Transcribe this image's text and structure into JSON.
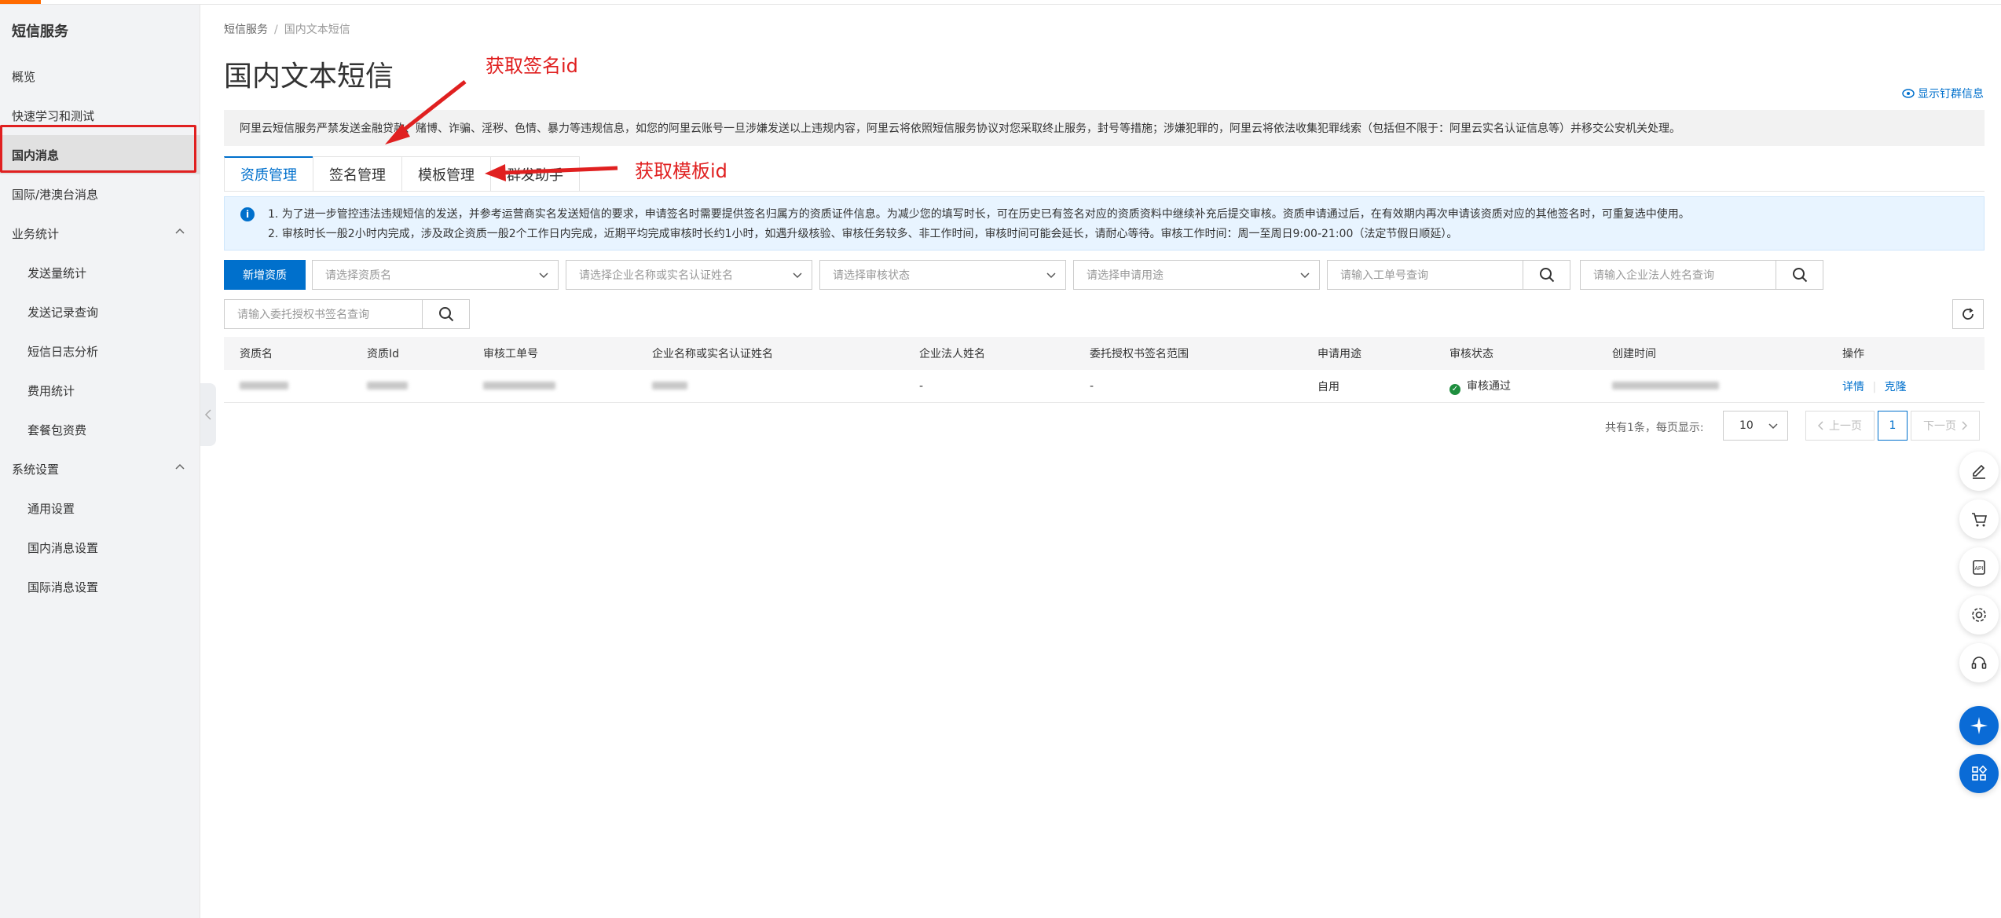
{
  "sidebar": {
    "title": "短信服务",
    "items": [
      {
        "label": "概览"
      },
      {
        "label": "快速学习和测试"
      },
      {
        "label": "国内消息"
      },
      {
        "label": "国际/港澳台消息"
      },
      {
        "label": "业务统计"
      },
      {
        "label": "发送量统计"
      },
      {
        "label": "发送记录查询"
      },
      {
        "label": "短信日志分析"
      },
      {
        "label": "费用统计"
      },
      {
        "label": "套餐包资费"
      },
      {
        "label": "系统设置"
      },
      {
        "label": "通用设置"
      },
      {
        "label": "国内消息设置"
      },
      {
        "label": "国际消息设置"
      }
    ]
  },
  "breadcrumb": {
    "root": "短信服务",
    "sep": "/",
    "current": "国内文本短信"
  },
  "page_title": "国内文本短信",
  "subscribe_link": "显示钉群信息",
  "warning_text": "阿里云短信服务严禁发送金融贷款、赌博、诈骗、淫秽、色情、暴力等违规信息，如您的阿里云账号一旦涉嫌发送以上违规内容，阿里云将依照短信服务协议对您采取终止服务，封号等措施；涉嫌犯罪的，阿里云将依法收集犯罪线索（包括但不限于：阿里云实名认证信息等）并移交公安机关处理。",
  "tabs": [
    {
      "label": "资质管理"
    },
    {
      "label": "签名管理"
    },
    {
      "label": "模板管理"
    },
    {
      "label": "群发助手"
    }
  ],
  "info": {
    "line1": "1. 为了进一步管控违法违规短信的发送，并参考运营商实名发送短信的要求，申请签名时需要提供签名归属方的资质证件信息。为减少您的填写时长，可在历史已有签名对应的资质资料中继续补充后提交审核。资质申请通过后，在有效期内再次申请该资质对应的其他签名时，可重复选中使用。",
    "line2": "2. 审核时长一般2小时内完成，涉及政企资质一般2个工作日内完成，近期平均完成审核时长约1小时，如遇升级核验、审核任务较多、非工作时间，审核时间可能会延长，请耐心等待。审核工作时间：周一至周日9:00-21:00（法定节假日顺延）。"
  },
  "filters": {
    "add_button": "新增资质",
    "select_qualification": "请选择资质名",
    "select_company": "请选择企业名称或实名认证姓名",
    "select_status": "请选择审核状态",
    "select_usage": "请选择申请用途",
    "input_ticket": "请输入工单号查询",
    "input_legal": "请输入企业法人姓名查询",
    "input_auth": "请输入委托授权书签名查询"
  },
  "table": {
    "headers": [
      "资质名",
      "资质Id",
      "审核工单号",
      "企业名称或实名认证姓名",
      "企业法人姓名",
      "委托授权书签名范围",
      "申请用途",
      "审核状态",
      "创建时间",
      "操作"
    ],
    "rows": [
      {
        "legal_name": "-",
        "auth_scope": "-",
        "usage": "自用",
        "status": "审核通过",
        "action_detail": "详情",
        "action_clone": "克隆"
      }
    ]
  },
  "pagination": {
    "total_text": "共有1条，每页显示:",
    "page_size": "10",
    "prev": "上一页",
    "current": "1",
    "next": "下一页"
  },
  "annotations": {
    "sign_id": "获取签名id",
    "template_id": "获取模板id"
  },
  "colors": {
    "primary": "#0070cc",
    "annotation_red": "#e02020",
    "success_green": "#1e8e3e",
    "accent_orange": "#ff6a00"
  },
  "float_toolbar_icons": [
    "edit-icon",
    "cart-icon",
    "api-icon",
    "settings-icon",
    "headset-icon",
    "ai-assistant-icon",
    "apps-icon"
  ]
}
